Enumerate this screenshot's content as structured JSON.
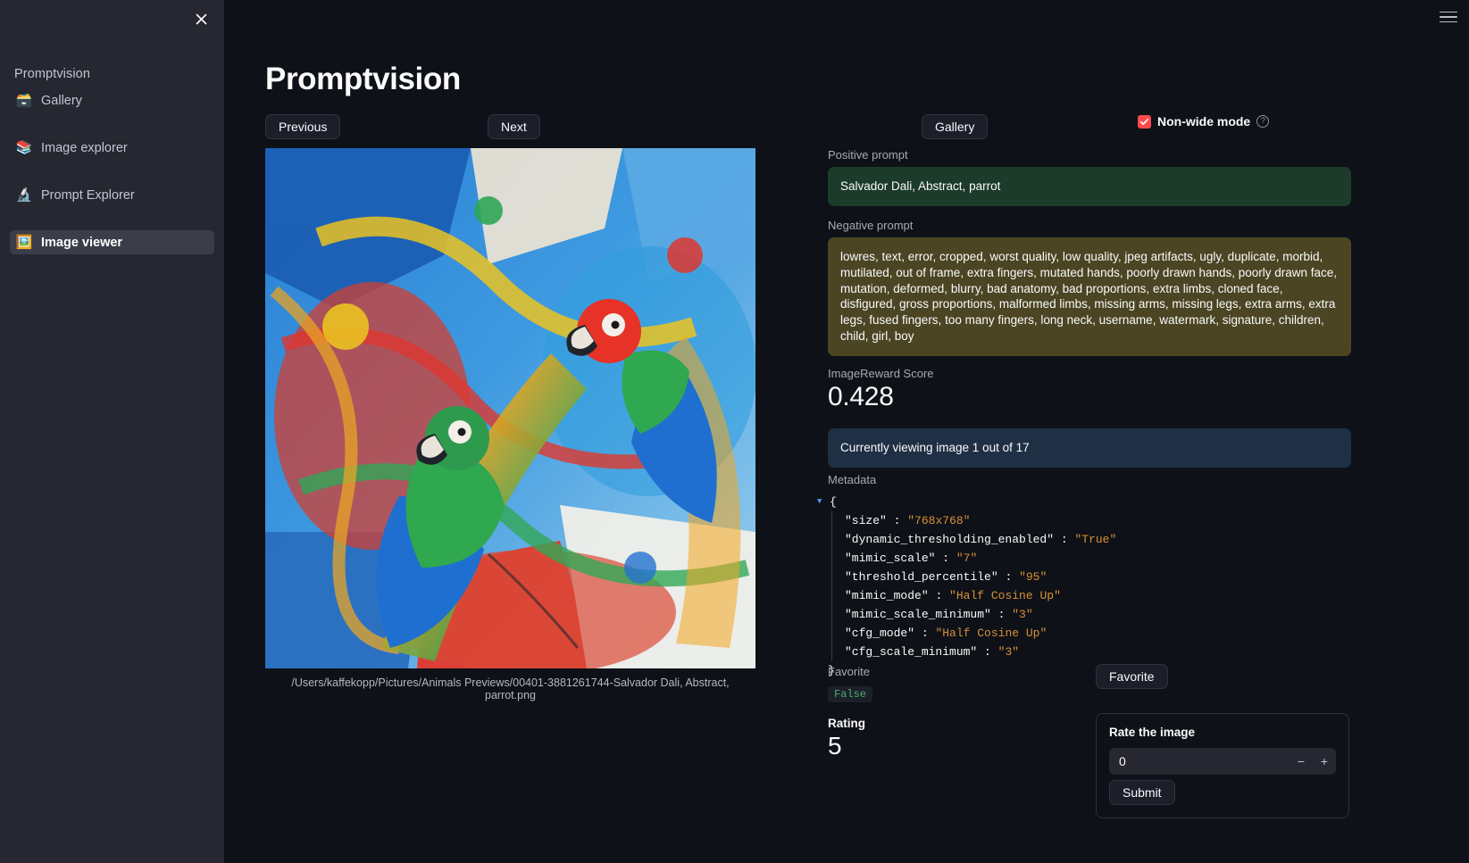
{
  "sidebar": {
    "close_icon": "close-icon",
    "title": "Promptvision",
    "items": [
      {
        "icon": "🗃️",
        "icon_name": "card-file-box-icon",
        "label": "Gallery"
      },
      {
        "icon": "📚",
        "icon_name": "books-icon",
        "label": "Image explorer"
      },
      {
        "icon": "🔬",
        "icon_name": "microscope-icon",
        "label": "Prompt Explorer"
      },
      {
        "icon": "🖼️",
        "icon_name": "framed-picture-icon",
        "label": "Image viewer"
      }
    ],
    "active_index": 3
  },
  "header": {
    "title": "Promptvision",
    "menu_icon": "hamburger-menu-icon"
  },
  "toolbar": {
    "previous_label": "Previous",
    "next_label": "Next",
    "gallery_label": "Gallery",
    "nonwide_label": "Non-wide mode",
    "nonwide_checked": true,
    "help_icon": "question-mark-circle-icon"
  },
  "image": {
    "caption": "/Users/kaffekopp/Pictures/Animals Previews/00401-3881261744-Salvador Dali, Abstract, parrot.png",
    "alt": "abstract-parrot-painting"
  },
  "prompts": {
    "positive_label": "Positive prompt",
    "positive_text": "Salvador Dali, Abstract, parrot",
    "negative_label": "Negative prompt",
    "negative_text": "lowres, text, error, cropped, worst quality, low quality, jpeg artifacts, ugly, duplicate, morbid, mutilated, out of frame, extra fingers, mutated hands, poorly drawn hands, poorly drawn face, mutation, deformed, blurry, bad anatomy, bad proportions, extra limbs, cloned face, disfigured, gross proportions, malformed limbs, missing arms, missing legs, extra arms, extra legs, fused fingers, too many fingers, long neck, username, watermark, signature, children, child, girl, boy"
  },
  "score": {
    "label": "ImageReward Score",
    "value": "0.428"
  },
  "status": {
    "viewing_text": "Currently viewing image 1 out of 17"
  },
  "metadata": {
    "label": "Metadata",
    "open_brace": "{",
    "close_brace": "}",
    "entries": [
      {
        "key": "\"size\"",
        "value": "\"768x768\""
      },
      {
        "key": "\"dynamic_thresholding_enabled\"",
        "value": "\"True\""
      },
      {
        "key": "\"mimic_scale\"",
        "value": "\"7\""
      },
      {
        "key": "\"threshold_percentile\"",
        "value": "\"95\""
      },
      {
        "key": "\"mimic_mode\"",
        "value": "\"Half Cosine Up\""
      },
      {
        "key": "\"mimic_scale_minimum\"",
        "value": "\"3\""
      },
      {
        "key": "\"cfg_mode\"",
        "value": "\"Half Cosine Up\""
      },
      {
        "key": "\"cfg_scale_minimum\"",
        "value": "\"3\""
      }
    ]
  },
  "favorite": {
    "label": "Favorite",
    "value": "False",
    "button_label": "Favorite"
  },
  "rating": {
    "label": "Rating",
    "value": "5",
    "form_title": "Rate the image",
    "input_value": "0",
    "decrement_label": "−",
    "increment_label": "+",
    "submit_label": "Submit"
  },
  "colors": {
    "app_background": "#0e1117",
    "sidebar_background": "#262730",
    "accent_red": "#ff4b4b",
    "success_green_bg": "#1d3b2a",
    "warning_olive_bg": "#4b4524",
    "info_blue_bg": "#1f3045",
    "json_value_orange": "#d9913a",
    "bool_green": "#4caf6d"
  }
}
